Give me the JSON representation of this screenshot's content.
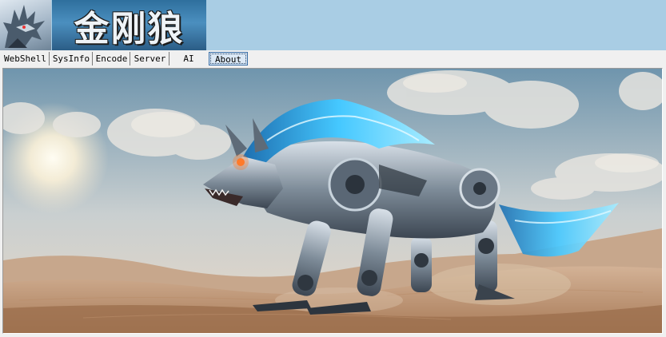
{
  "header": {
    "logo_title": "金刚狼",
    "icon": "wolf-head-icon"
  },
  "tabs": [
    {
      "label": "WebShell",
      "active": false
    },
    {
      "label": "SysInfo",
      "active": false
    },
    {
      "label": "Encode",
      "active": false
    },
    {
      "label": "Server",
      "active": false
    },
    {
      "label": "AI",
      "active": false
    },
    {
      "label": "About",
      "active": true
    }
  ],
  "about": {
    "image": "robotic-wolf-desert-illustration"
  },
  "colors": {
    "header_bg": "#a9cde4",
    "accent_glow": "#38c2ff",
    "sand": "#c49b78"
  }
}
